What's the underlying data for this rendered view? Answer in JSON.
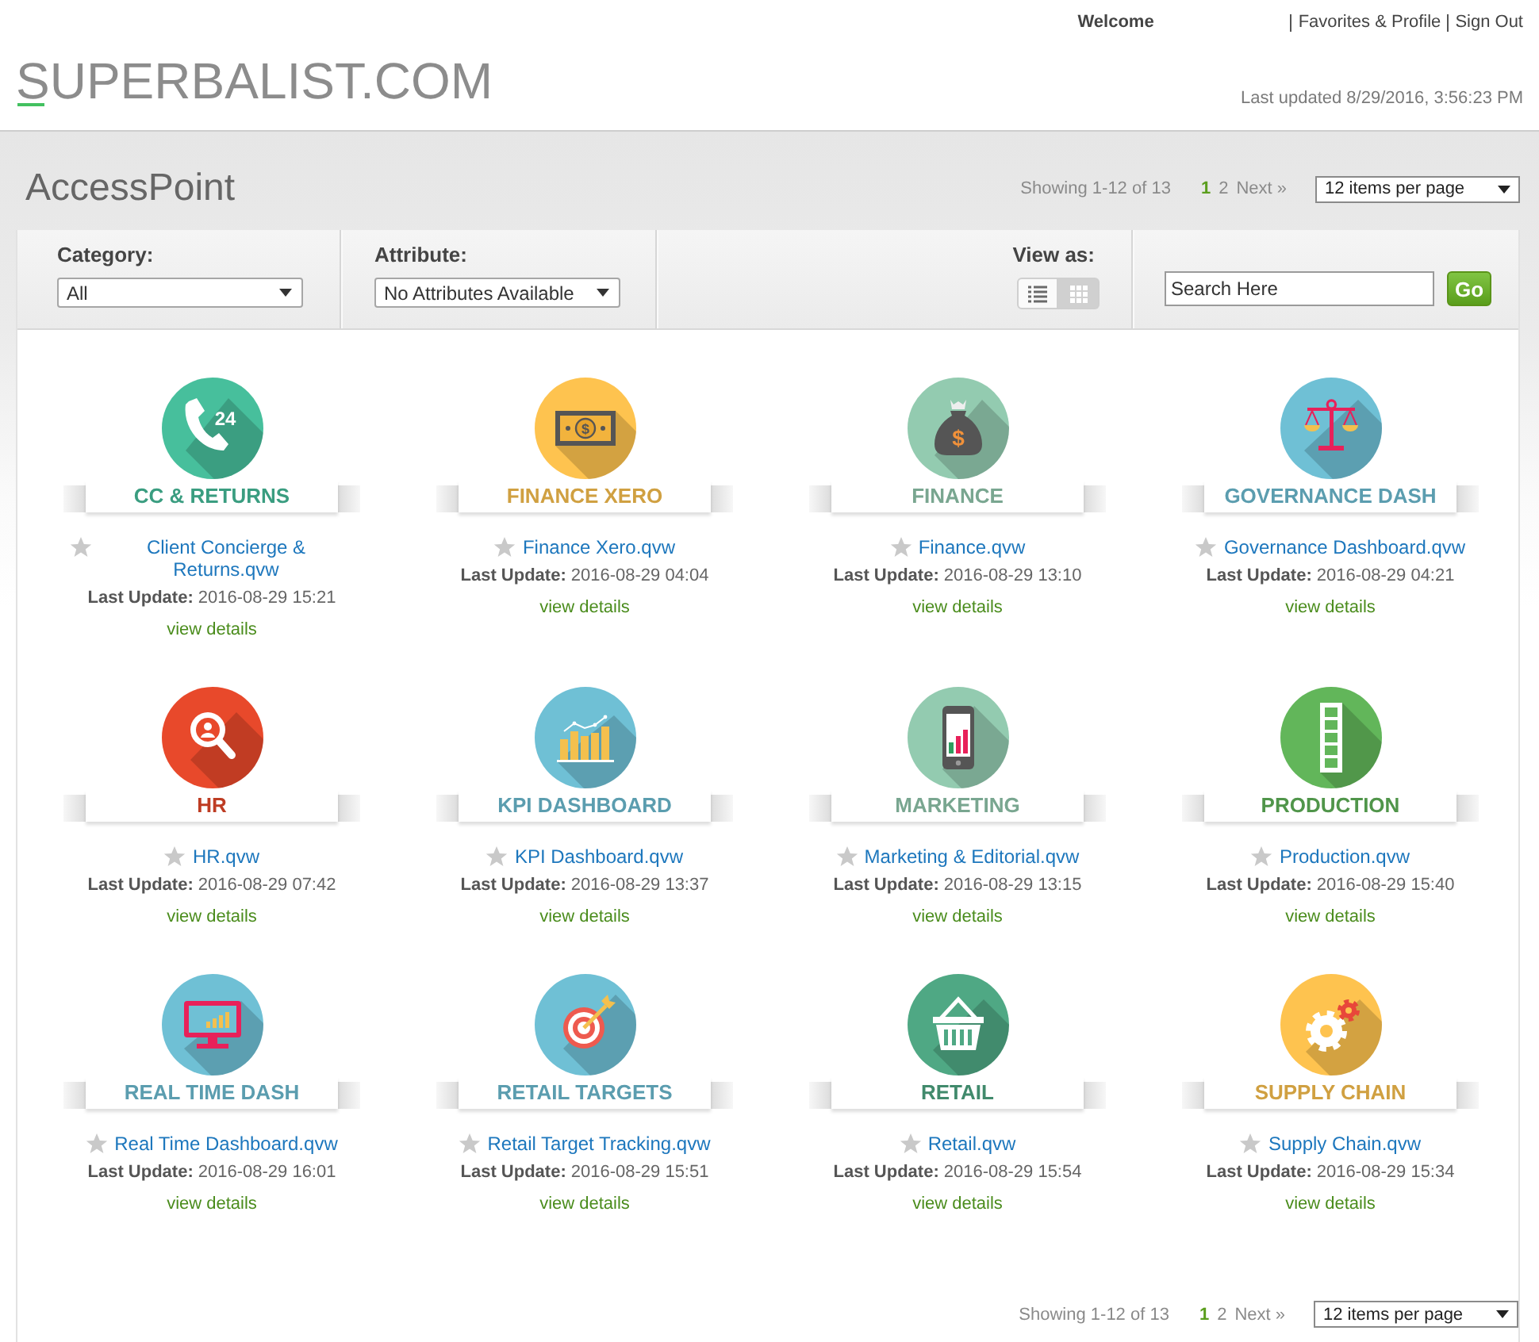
{
  "header": {
    "logo": "SUPERBALIST.COM",
    "welcome": "Welcome",
    "links": [
      "Favorites & Profile",
      "Sign Out"
    ],
    "last_updated": "Last updated 8/29/2016, 3:56:23 PM"
  },
  "page_title": "AccessPoint",
  "pagination_top": {
    "summary": "Showing 1-12 of 13",
    "pages": [
      {
        "label": "1",
        "selected": true
      },
      {
        "label": "2",
        "selected": false
      }
    ],
    "next": "Next »",
    "per_page": "12 items per page"
  },
  "filters": {
    "category": {
      "label": "Category:",
      "value": "All"
    },
    "attribute": {
      "label": "Attribute:",
      "value": "No Attributes Available"
    },
    "view": {
      "label": "View as:",
      "options": [
        {
          "kind": "list",
          "selected": false
        },
        {
          "kind": "grid",
          "selected": true
        }
      ]
    },
    "search": {
      "value": "Search Here",
      "button": "Go"
    }
  },
  "tiles": [
    {
      "kind": "phone",
      "icon_label": "24",
      "title": "CC & RETURNS",
      "color": "#47bf9c",
      "file": "Client Concierge & Returns.qvw",
      "favorite": false,
      "update_label": "Last Update:",
      "updated": "2016-08-29 15:21",
      "details": "view details"
    },
    {
      "kind": "banknote",
      "icon_label": "$",
      "title": "FINANCE XERO",
      "color": "#fec34f",
      "file": "Finance Xero.qvw",
      "favorite": false,
      "update_label": "Last Update:",
      "updated": "2016-08-29 04:04",
      "details": "view details"
    },
    {
      "kind": "moneybag",
      "icon_label": "$",
      "title": "FINANCE",
      "color": "#93cbb0",
      "file": "Finance.qvw",
      "favorite": false,
      "update_label": "Last Update:",
      "updated": "2016-08-29 13:10",
      "details": "view details"
    },
    {
      "kind": "scales",
      "title": "GOVERNANCE DASH",
      "color": "#6fc0d5",
      "file": "Governance Dashboard.qvw",
      "favorite": false,
      "update_label": "Last Update:",
      "updated": "2016-08-29 04:21",
      "details": "view details"
    },
    {
      "kind": "magnifier",
      "title": "HR",
      "color": "#e8492b",
      "file": "HR.qvw",
      "favorite": false,
      "update_label": "Last Update:",
      "updated": "2016-08-29 07:42",
      "details": "view details"
    },
    {
      "kind": "barchart",
      "title": "KPI DASHBOARD",
      "color": "#6fc0d5",
      "file": "KPI Dashboard.qvw",
      "favorite": false,
      "update_label": "Last Update:",
      "updated": "2016-08-29 13:37",
      "details": "view details"
    },
    {
      "kind": "tablet",
      "title": "MARKETING",
      "color": "#93cbb0",
      "file": "Marketing & Editorial.qvw",
      "favorite": false,
      "update_label": "Last Update:",
      "updated": "2016-08-29 13:15",
      "details": "view details"
    },
    {
      "kind": "filmstrip",
      "title": "PRODUCTION",
      "color": "#62b65a",
      "file": "Production.qvw",
      "favorite": false,
      "update_label": "Last Update:",
      "updated": "2016-08-29 15:40",
      "details": "view details"
    },
    {
      "kind": "monitor",
      "title": "REAL TIME DASH",
      "color": "#6fc0d5",
      "file": "Real Time Dashboard.qvw",
      "favorite": false,
      "update_label": "Last Update:",
      "updated": "2016-08-29 16:01",
      "details": "view details"
    },
    {
      "kind": "target",
      "title": "RETAIL TARGETS",
      "color": "#6fc0d5",
      "file": "Retail Target Tracking.qvw",
      "favorite": false,
      "update_label": "Last Update:",
      "updated": "2016-08-29 15:51",
      "details": "view details"
    },
    {
      "kind": "basket",
      "title": "RETAIL",
      "color": "#4fa884",
      "file": "Retail.qvw",
      "favorite": false,
      "update_label": "Last Update:",
      "updated": "2016-08-29 15:54",
      "details": "view details"
    },
    {
      "kind": "gears",
      "title": "SUPPLY CHAIN",
      "color": "#fec34f",
      "file": "Supply Chain.qvw",
      "favorite": false,
      "update_label": "Last Update:",
      "updated": "2016-08-29 15:34",
      "details": "view details"
    }
  ],
  "pagination_bottom": {
    "summary": "Showing 1-12 of 13",
    "pages": [
      {
        "label": "1",
        "selected": true
      },
      {
        "label": "2",
        "selected": false
      }
    ],
    "next": "Next »",
    "per_page": "12 items per page"
  }
}
